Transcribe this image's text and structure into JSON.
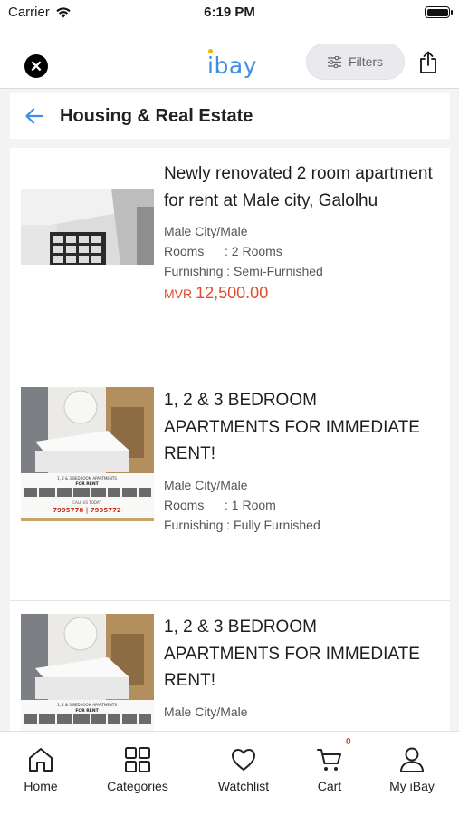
{
  "status_bar": {
    "carrier": "Carrier",
    "time": "6:19 PM"
  },
  "header": {
    "logo": "ibay",
    "filters_label": "Filters",
    "icons": {
      "close": "close-circle-icon",
      "filters": "sliders-icon",
      "share": "share-icon"
    }
  },
  "breadcrumb": {
    "title": "Housing & Real Estate",
    "back_icon": "arrow-left-icon"
  },
  "listings": [
    {
      "title": "Newly renovated 2 room apartment for rent at Male city, Galolhu",
      "location": "Male City/Male",
      "rooms_label": "Rooms",
      "rooms_value": ": 2 Rooms",
      "furnishing": "Furnishing : Semi-Furnished",
      "price_currency": "MVR",
      "price": "12,500.00"
    },
    {
      "title": "1, 2 & 3 BEDROOM APARTMENTS FOR IMMEDIATE RENT!",
      "location": "Male City/Male",
      "rooms_label": "Rooms",
      "rooms_value": ": 1 Room",
      "furnishing": "Furnishing : Fully Furnished",
      "thumb_text": {
        "heading": "1, 2 & 3 BEDROOM APARTMENTS",
        "sub": "FOR RENT",
        "call": "CALL US TODAY",
        "phones": "7995778 | 7995772"
      }
    },
    {
      "title": "1, 2 & 3 BEDROOM APARTMENTS FOR IMMEDIATE RENT!",
      "location": "Male City/Male",
      "thumb_text": {
        "heading": "1, 2 & 3 BEDROOM APARTMENTS",
        "sub": "FOR RENT"
      }
    }
  ],
  "tabbar": {
    "items": [
      {
        "label": "Home",
        "icon": "home-icon"
      },
      {
        "label": "Categories",
        "icon": "grid-icon"
      },
      {
        "label": "Watchlist",
        "icon": "heart-icon"
      },
      {
        "label": "Cart",
        "icon": "cart-icon"
      },
      {
        "label": "My iBay",
        "icon": "user-icon"
      }
    ],
    "cart_count": "0"
  },
  "colors": {
    "accent": "#3f8ee0",
    "price": "#e04a2e",
    "badge": "#e53935"
  }
}
